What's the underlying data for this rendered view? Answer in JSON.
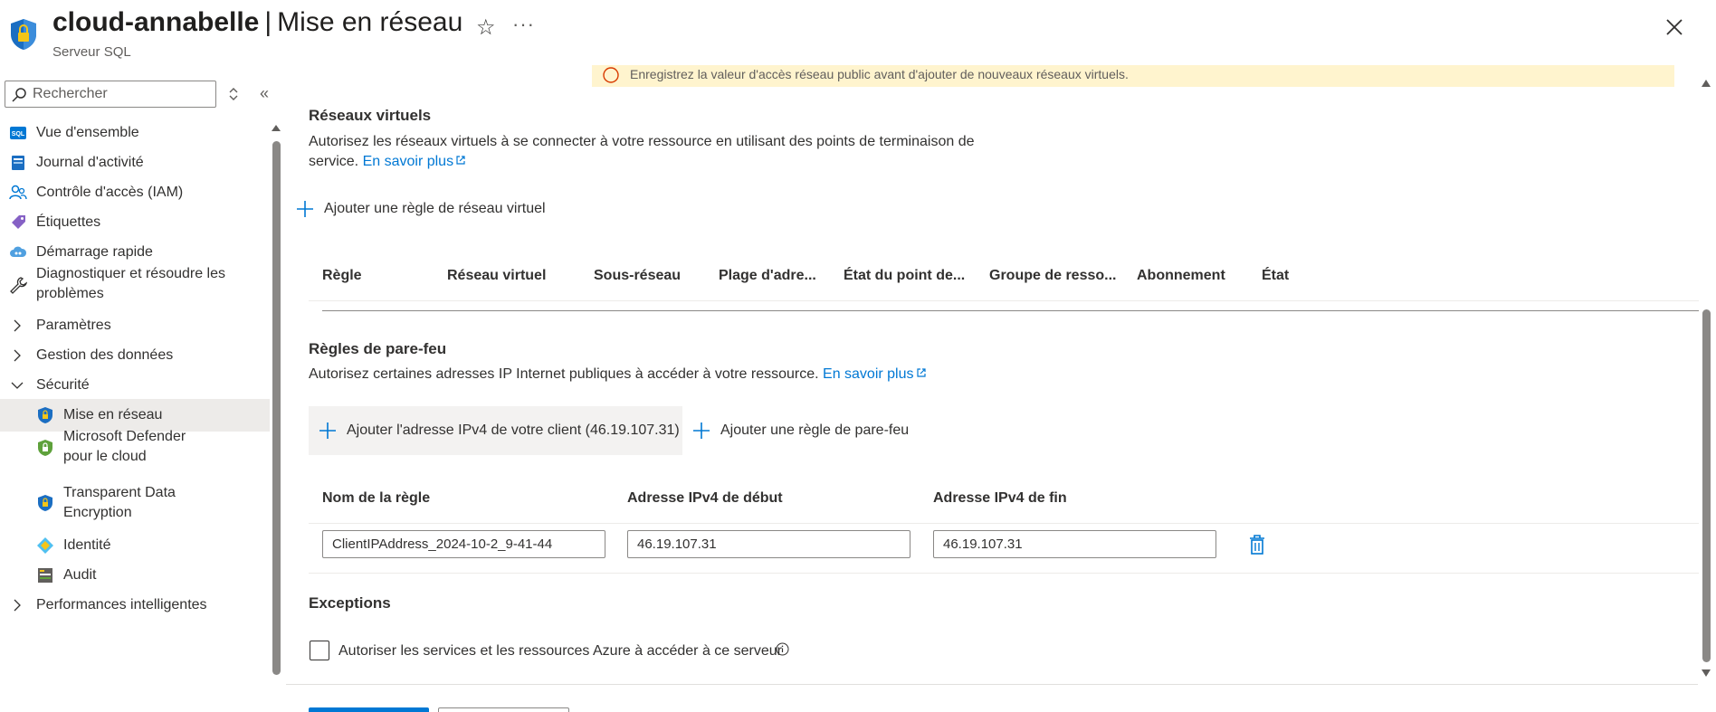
{
  "header": {
    "resource_name": "cloud-annabelle",
    "separator": "|",
    "page_name": "Mise en réseau",
    "subtitle": "Serveur SQL",
    "favorite_icon": "star-icon",
    "more_icon": "ellipsis-icon",
    "close_icon": "close-icon"
  },
  "sidebar": {
    "search_placeholder": "Rechercher",
    "items": [
      {
        "label": "Vue d'ensemble",
        "icon": "sql-icon"
      },
      {
        "label": "Journal d'activité",
        "icon": "log-icon"
      },
      {
        "label": "Contrôle d'accès (IAM)",
        "icon": "people-icon"
      },
      {
        "label": "Étiquettes",
        "icon": "tag-icon"
      },
      {
        "label": "Démarrage rapide",
        "icon": "cloud-icon"
      },
      {
        "label_line1": "Diagnostiquer et résoudre les",
        "label_line2": "problèmes",
        "icon": "wrench-icon"
      },
      {
        "label": "Paramètres",
        "icon": "chevron-right-icon"
      },
      {
        "label": "Gestion des données",
        "icon": "chevron-right-icon"
      },
      {
        "label": "Sécurité",
        "icon": "chevron-down-icon"
      },
      {
        "label": "Mise en réseau",
        "icon": "shield-icon",
        "active": true
      },
      {
        "label_line1": "Microsoft Defender",
        "label_line2": "pour le cloud",
        "icon": "defender-icon"
      },
      {
        "label_line1": "Transparent Data",
        "label_line2": "Encryption",
        "icon": "shield-icon"
      },
      {
        "label": "Identité",
        "icon": "identity-icon"
      },
      {
        "label": "Audit",
        "icon": "audit-icon"
      },
      {
        "label": "Performances intelligentes",
        "icon": "chevron-right-icon"
      }
    ]
  },
  "warning": {
    "text": "Enregistrez la valeur d'accès réseau public avant d'ajouter de nouveaux réseaux virtuels."
  },
  "vnet": {
    "title": "Réseaux virtuels",
    "desc_line1": "Autorisez les réseaux virtuels à se connecter à votre ressource en utilisant des points de terminaison de",
    "desc_line2": "service.",
    "learn_more": "En savoir plus",
    "add_rule": "Ajouter une règle de réseau virtuel",
    "columns": [
      "Règle",
      "Réseau virtuel",
      "Sous-réseau",
      "Plage d'adre...",
      "État du point de...",
      "Groupe de resso...",
      "Abonnement",
      "État"
    ]
  },
  "firewall": {
    "title": "Règles de pare-feu",
    "desc": "Autorisez certaines adresses IP Internet publiques à accéder à votre ressource.",
    "learn_more": "En savoir plus",
    "add_client_ip": "Ajouter l'adresse IPv4 de votre client (46.19.107.31)",
    "add_rule": "Ajouter une règle de pare-feu",
    "columns": [
      "Nom de la règle",
      "Adresse IPv4 de début",
      "Adresse IPv4 de fin"
    ],
    "rows": [
      {
        "name": "ClientIPAddress_2024-10-2_9-41-44",
        "start": "46.19.107.31",
        "end": "46.19.107.31"
      }
    ]
  },
  "exceptions": {
    "title": "Exceptions",
    "allow_azure": "Autoriser les services et les ressources Azure à accéder à ce serveur",
    "allow_azure_checked": false
  },
  "colors": {
    "accent": "#0078d4",
    "active_nav": "#edebe9",
    "warning_bg": "#fff4ce"
  }
}
